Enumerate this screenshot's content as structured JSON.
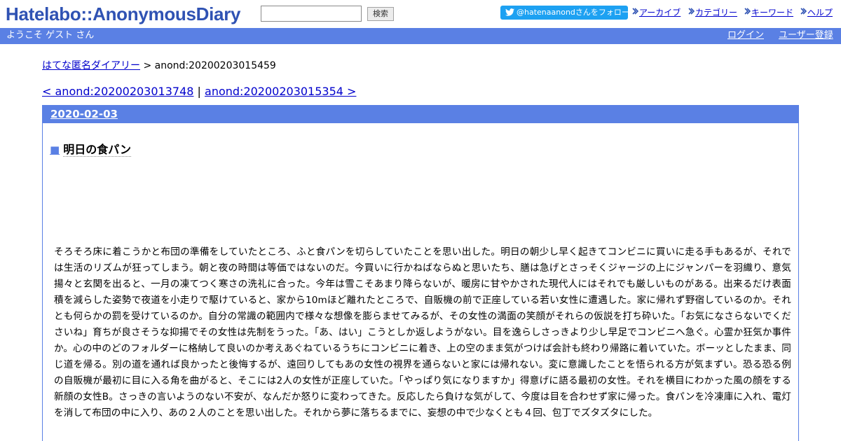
{
  "header": {
    "logo": "Hatelabo::AnonymousDiary",
    "search_placeholder": "",
    "search_button": "検索",
    "follow_button": "@hatenaanondさんをフォロー",
    "links": [
      "アーカイブ",
      "カテゴリー",
      "キーワード",
      "ヘルプ"
    ]
  },
  "navbar": {
    "welcome": "ようこそ ゲスト さん",
    "login": "ログイン",
    "register": "ユーザー登録"
  },
  "breadcrumb": {
    "home": "はてな匿名ダイアリー",
    "separator": ">",
    "current": "anond:20200203015459"
  },
  "pager": {
    "prev": "< anond:20200203013748",
    "separator": "|",
    "next": "anond:20200203015354 >"
  },
  "day": {
    "date": "2020-02-03",
    "entry_marker": "■",
    "entry_title": "明日の食パン",
    "entry_body": "そろそろ床に着こうかと布団の準備をしていたところ、ふと食パンを切らしていたことを思い出した。明日の朝少し早く起きてコンビニに買いに走る手もあるが、それでは生活のリズムが狂ってしまう。朝と夜の時間は等価ではないのだ。今買いに行かねばならぬと思いたち、膳は急げとさっそくジャージの上にジャンパーを羽織り、意気揚々と玄関を出ると、一月の凍てつく寒さの洗礼に合った。今年は雪こそあまり降らないが、暖房に甘やかされた現代人にはそれでも厳しいものがある。出来るだけ表面積を減らした姿勢で夜道を小走りで駆けていると、家から10mほど離れたところで、自販機の前で正座している若い女性に遭遇した。家に帰れず野宿しているのか。それとも何らかの罰を受けているのか。自分の常識の範囲内で様々な想像を膨らませてみるが、その女性の満面の笑顔がそれらの仮説を打ち砕いた。「お気になさらないでくださいね」育ちが良さそうな抑揚でその女性は先制をうった。「あ、はい」こうとしか返しようがない。目を逸らしさっきより少し早足でコンビニへ急ぐ。心霊か狂気か事件か。心の中のどのフォルダーに格納して良いのか考えあぐねているうちにコンビニに着き、上の空のまま気がつけば会計も終わり帰路に着いていた。ボーッとしたまま、同じ道を帰る。別の道を通れば良かったと後悔するが、遠回りしてもあの女性の視界を通らないと家には帰れない。変に意識したことを悟られる方が気まずい。恐る恐る例の自販機が最初に目に入る角を曲がると、そこには2人の女性が正座していた。「やっぱり気になりますか」得意げに語る最初の女性。それを横目にわかった風の顔をする新顔の女性B。さっきの言いようのない不安が、なんだか怒りに変わってきた。反応したら負けな気がして、今度は目を合わせず家に帰った。食パンを冷凍庫に入れ、電灯を消して布団の中に入り、あの２人のことを思い出した。それから夢に落ちるまでに、妄想の中で少なくとも４回、包丁でズタズタにした。"
  },
  "colors": {
    "logo": "#2f52b3",
    "navbar": "#5a80e4",
    "link": "#0000cc",
    "twitter": "#1da1f2"
  }
}
